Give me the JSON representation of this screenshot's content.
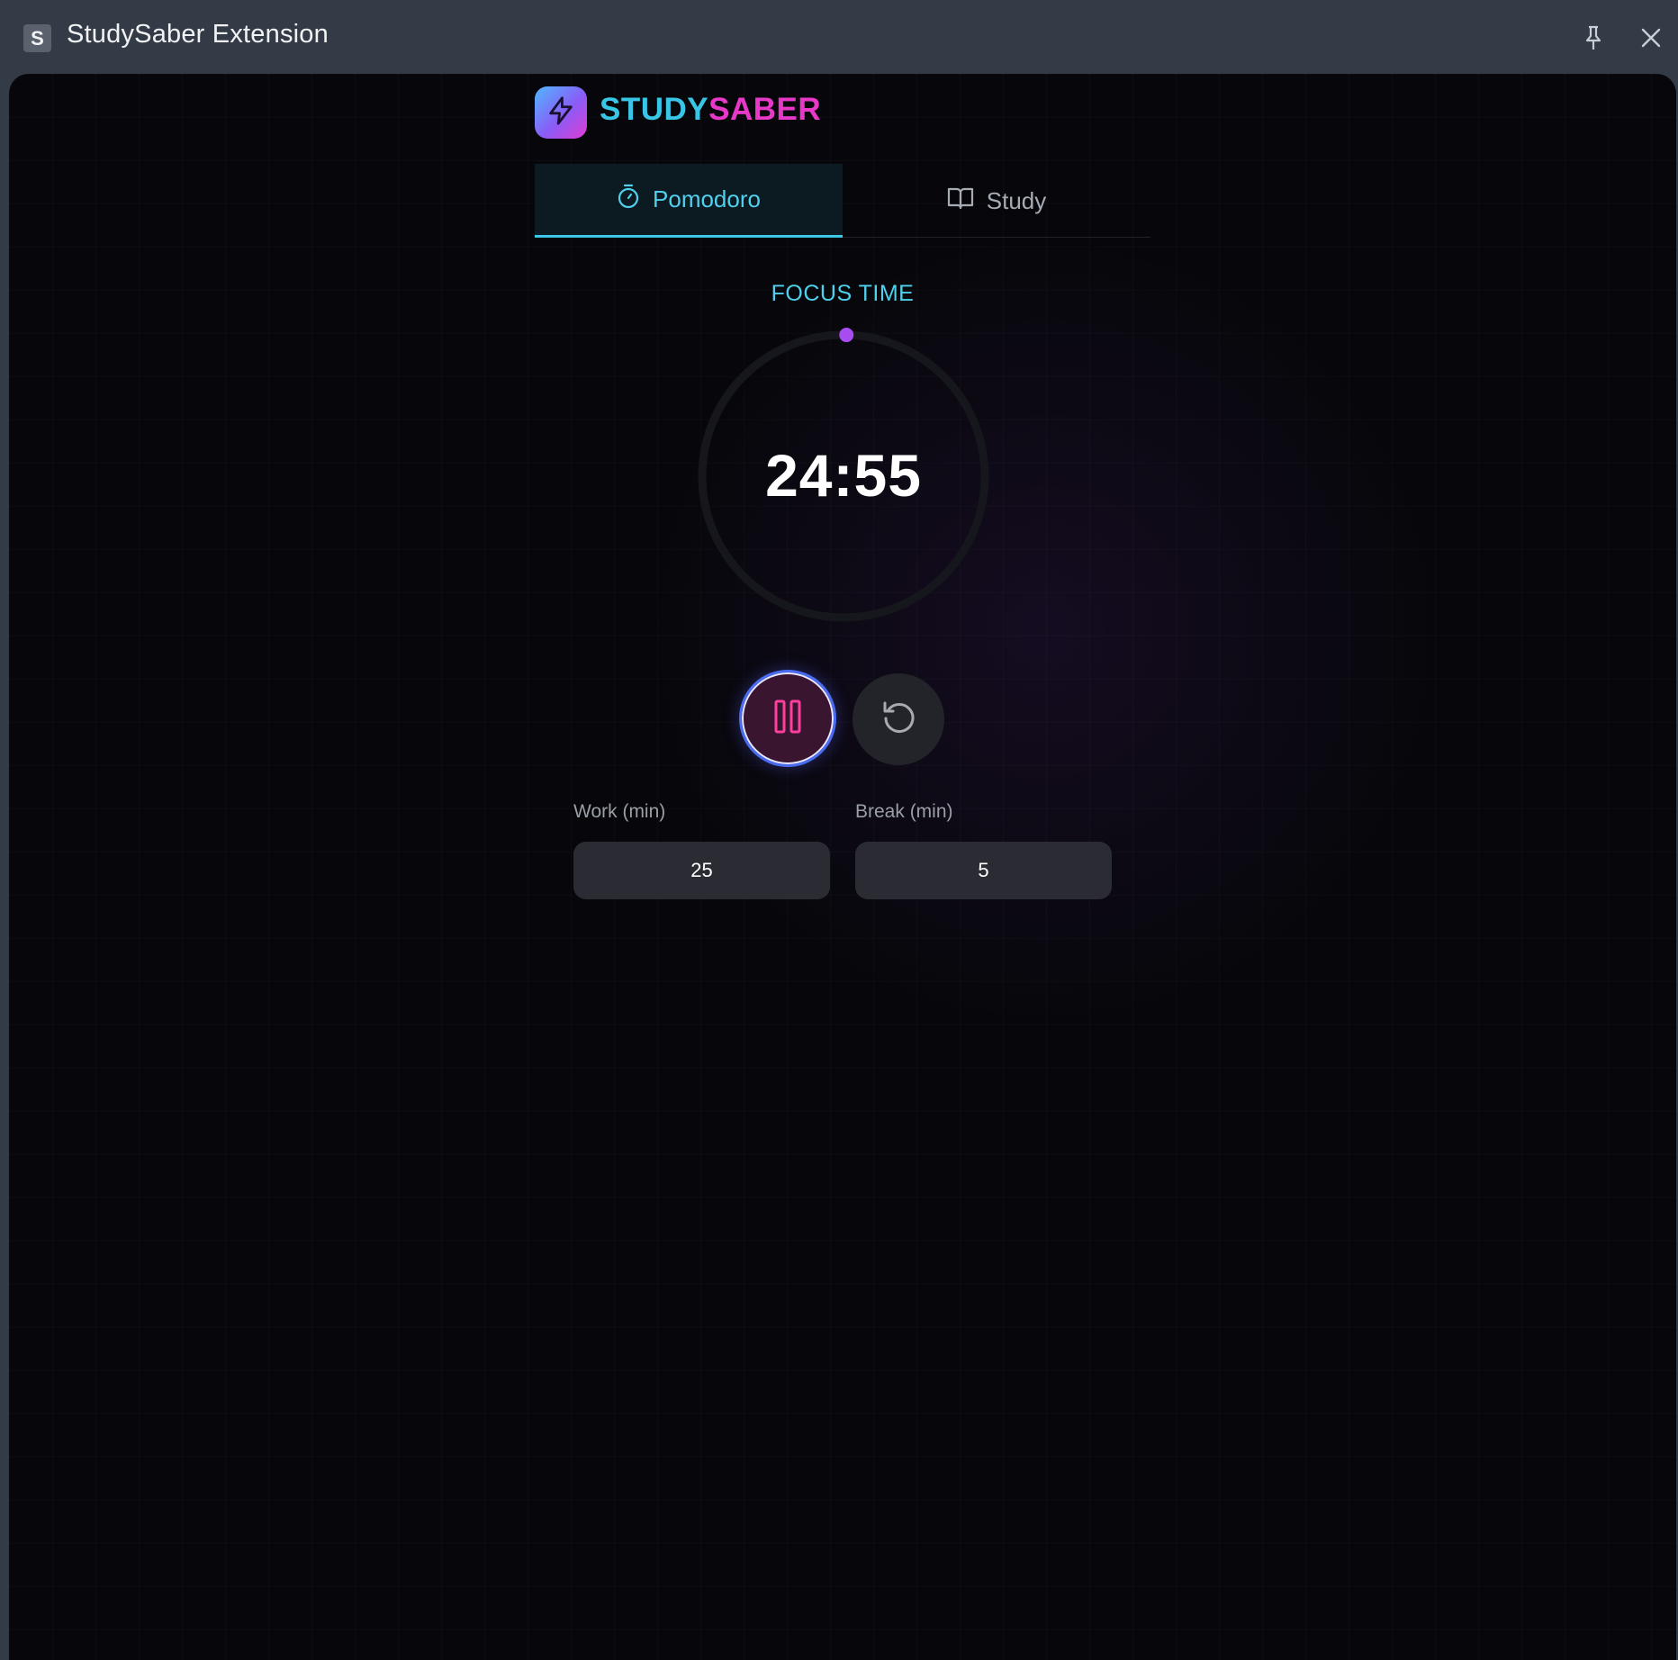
{
  "window": {
    "badge": "S",
    "title": "StudySaber Extension",
    "pin_icon": "pin-icon",
    "close_icon": "close-icon"
  },
  "brand": {
    "name_part1": "STUDY",
    "name_part2": "SABER",
    "logo_icon": "lightning-bolt-icon",
    "color_part1": "#39c6e6",
    "color_part2": "#e838c8"
  },
  "tabs": [
    {
      "label": "Pomodoro",
      "icon": "stopwatch-icon",
      "active": true
    },
    {
      "label": "Study",
      "icon": "open-book-icon",
      "active": false
    }
  ],
  "timer": {
    "mode_label": "FOCUS TIME",
    "time": "24:55",
    "progress_fraction": 0.0033,
    "ring_accent": "#a64cf0"
  },
  "controls": {
    "pause_icon": "pause-icon",
    "reset_icon": "reset-icon"
  },
  "settings": {
    "work_label": "Work (min)",
    "work_value": "25",
    "break_label": "Break (min)",
    "break_value": "5"
  }
}
